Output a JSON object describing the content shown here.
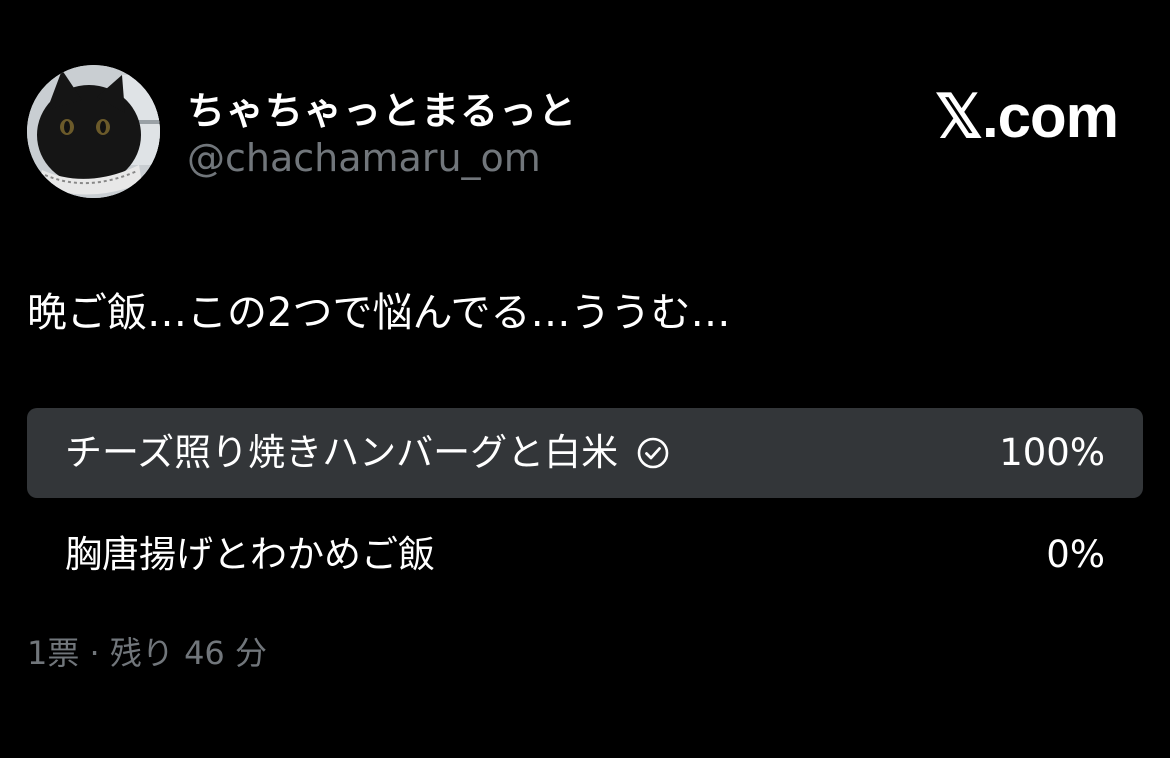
{
  "author": {
    "display_name": "ちゃちゃっとまるっと",
    "handle": "@chachamaru_om",
    "avatar": "black-cat-photo"
  },
  "brand": {
    "label": "𝕏.com"
  },
  "tweet": {
    "text": "晩ご飯…この2つで悩んでる…ううむ…"
  },
  "poll": {
    "options": [
      {
        "label": "チーズ照り焼きハンバーグと白米",
        "percent_label": "100%",
        "percent": 100,
        "selected": true,
        "icon": "check-circle-icon"
      },
      {
        "label": "胸唐揚げとわかめご飯",
        "percent_label": "0%",
        "percent": 0,
        "selected": false
      }
    ],
    "votes": "1票",
    "separator": "·",
    "remaining": "残り 46 分"
  },
  "colors": {
    "background": "#000000",
    "text_primary": "#ffffff",
    "text_secondary": "#71767b",
    "poll_fill": "#333639"
  }
}
